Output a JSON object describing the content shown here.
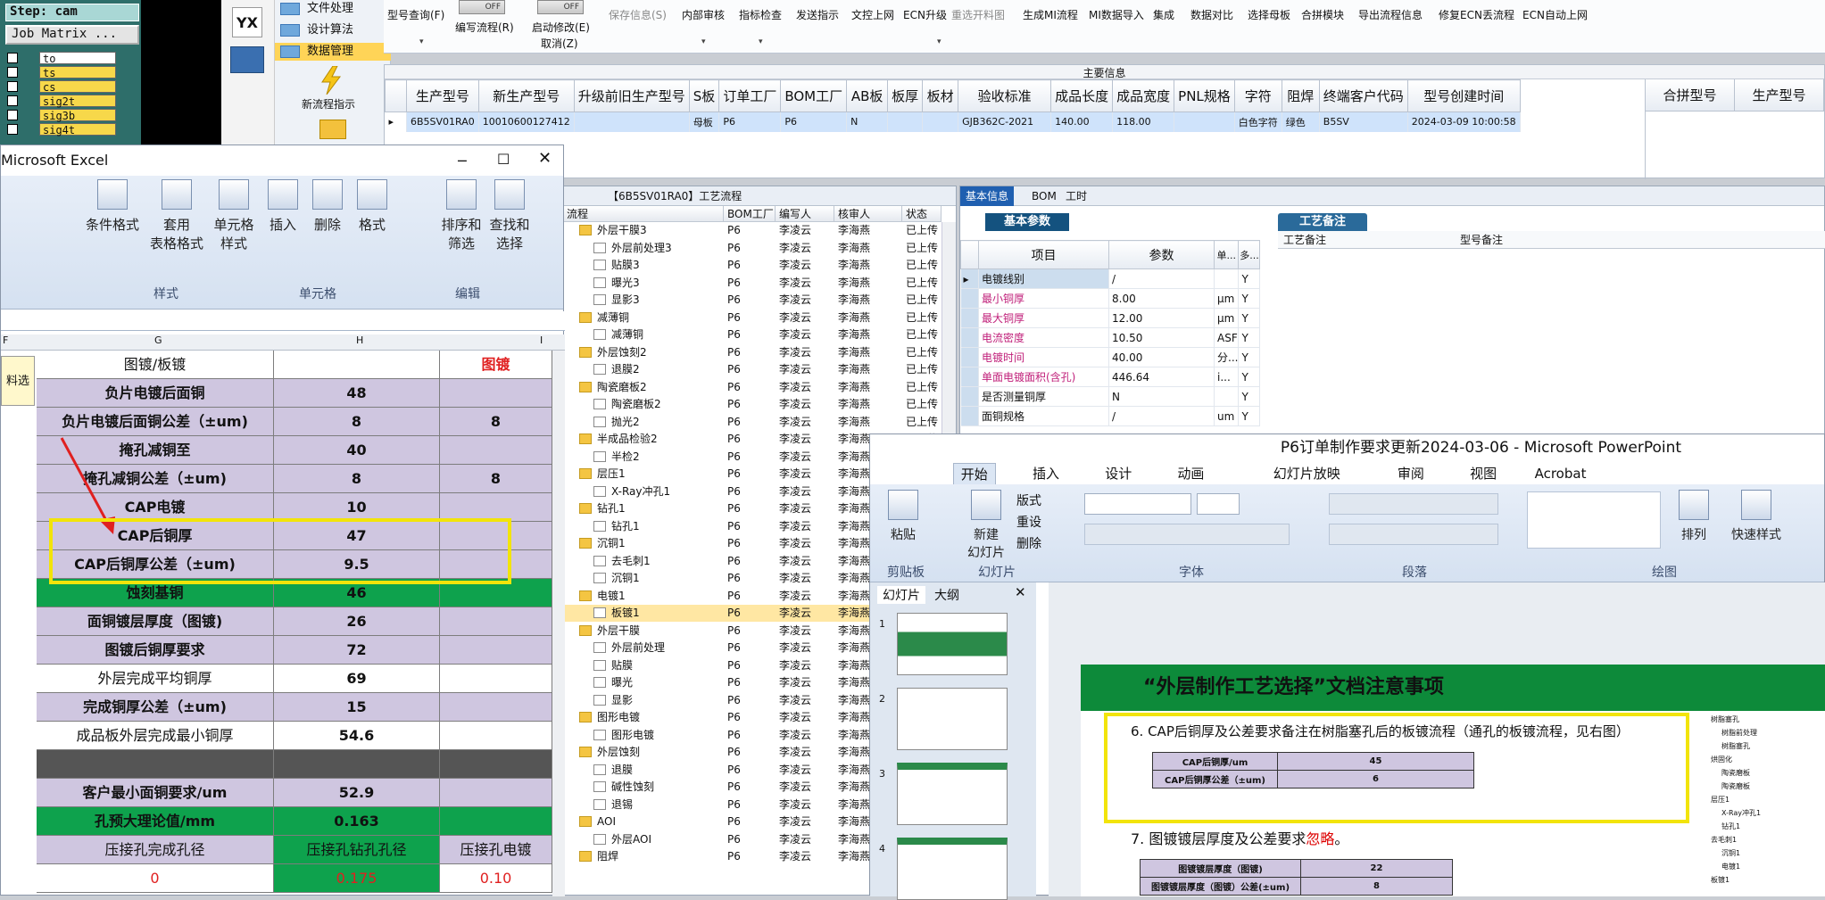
{
  "genesis": {
    "step": "Step: cam",
    "job_matrix": "Job Matrix ...",
    "layers": [
      "to",
      "ts",
      "cs",
      "sig2t",
      "sig3b",
      "sig4t"
    ]
  },
  "erp_nav": {
    "logo": "YX",
    "new_process": "新流程指示"
  },
  "erp_menu": [
    "文件处理",
    "设计算法",
    "数据管理"
  ],
  "toolbar": {
    "items": [
      "型号查询(F)",
      "编写流程(R)",
      "启动修改(E)",
      "取消(Z)",
      "保存信息(S)",
      "内部审核",
      "指标检查",
      "发送指示",
      "文控上网",
      "ECN升级",
      "重选开料图",
      "生成MI流程",
      "MI数据导入",
      "集成",
      "数据对比",
      "选择母板",
      "合拼模块",
      "导出流程信息",
      "修复ECN丢流程",
      "ECN自动上网"
    ],
    "toggle_off": "OFF"
  },
  "main_info": {
    "caption": "主要信息",
    "columns": [
      "生产型号",
      "新生产型号",
      "升级前旧生产型号",
      "S板",
      "订单工厂",
      "BOM工厂",
      "AB板",
      "板厚",
      "板材",
      "验收标准",
      "成品长度",
      "成品宽度",
      "PNL规格",
      "字符",
      "阻焊",
      "终端客户代码",
      "型号创建时间"
    ],
    "right_columns": [
      "合拼型号",
      "生产型号"
    ],
    "row": [
      "6B5SV01RA0",
      "10010600127412",
      "",
      "母板",
      "P6",
      "P6",
      "N",
      "",
      "",
      "GJB362C-2021",
      "140.00",
      "118.00",
      "",
      "白色字符",
      "绿色",
      "B5SV",
      "2024-03-09 10:00:58"
    ]
  },
  "process": {
    "header": "【6B5SV01RA0】工艺流程",
    "columns": [
      "流程",
      "BOM工厂",
      "编写人",
      "核审人",
      "状态"
    ],
    "rows": [
      {
        "lvl": 1,
        "name": "外层干膜3",
        "f": true
      },
      {
        "lvl": 2,
        "name": "外层前处理3"
      },
      {
        "lvl": 2,
        "name": "贴膜3"
      },
      {
        "lvl": 2,
        "name": "曝光3"
      },
      {
        "lvl": 2,
        "name": "显影3"
      },
      {
        "lvl": 1,
        "name": "减薄铜",
        "f": true
      },
      {
        "lvl": 2,
        "name": "减薄铜"
      },
      {
        "lvl": 1,
        "name": "外层蚀刻2",
        "f": true
      },
      {
        "lvl": 2,
        "name": "退膜2"
      },
      {
        "lvl": 1,
        "name": "陶瓷磨板2",
        "f": true
      },
      {
        "lvl": 2,
        "name": "陶瓷磨板2"
      },
      {
        "lvl": 2,
        "name": "抛光2"
      },
      {
        "lvl": 1,
        "name": "半成品检验2",
        "f": true
      },
      {
        "lvl": 2,
        "name": "半检2"
      },
      {
        "lvl": 1,
        "name": "层压1",
        "f": true
      },
      {
        "lvl": 2,
        "name": "X-Ray冲孔1"
      },
      {
        "lvl": 1,
        "name": "钻孔1",
        "f": true
      },
      {
        "lvl": 2,
        "name": "钻孔1"
      },
      {
        "lvl": 1,
        "name": "沉铜1",
        "f": true
      },
      {
        "lvl": 2,
        "name": "去毛刺1"
      },
      {
        "lvl": 2,
        "name": "沉铜1"
      },
      {
        "lvl": 1,
        "name": "电镀1",
        "f": true
      },
      {
        "lvl": 2,
        "name": "板镀1",
        "sel": true
      },
      {
        "lvl": 1,
        "name": "外层干膜",
        "f": true
      },
      {
        "lvl": 2,
        "name": "外层前处理"
      },
      {
        "lvl": 2,
        "name": "贴膜"
      },
      {
        "lvl": 2,
        "name": "曝光"
      },
      {
        "lvl": 2,
        "name": "显影"
      },
      {
        "lvl": 1,
        "name": "图形电镀",
        "f": true
      },
      {
        "lvl": 2,
        "name": "图形电镀"
      },
      {
        "lvl": 1,
        "name": "外层蚀刻",
        "f": true
      },
      {
        "lvl": 2,
        "name": "退膜"
      },
      {
        "lvl": 2,
        "name": "碱性蚀刻"
      },
      {
        "lvl": 2,
        "name": "退锡"
      },
      {
        "lvl": 1,
        "name": "AOI",
        "f": true
      },
      {
        "lvl": 2,
        "name": "外层AOI"
      },
      {
        "lvl": 1,
        "name": "阻焊",
        "f": true
      }
    ],
    "bom": "P6",
    "writer": "李凌云",
    "checker": "李海燕",
    "status": "已上传"
  },
  "basic": {
    "tabs": [
      "基本信息",
      "BOM",
      "工时"
    ],
    "params_title": "基本参数",
    "remarks_title": "工艺备注",
    "remarks_cols": [
      "工艺备注",
      "型号备注"
    ],
    "cols": [
      "项目",
      "参数",
      "单...",
      "多..."
    ],
    "rows": [
      [
        "电镀线别",
        "/",
        "",
        "Y"
      ],
      [
        "最小铜厚",
        "8.00",
        "μm",
        "Y"
      ],
      [
        "最大铜厚",
        "12.00",
        "μm",
        "Y"
      ],
      [
        "电流密度",
        "10.50",
        "ASF",
        "Y"
      ],
      [
        "电镀时间",
        "40.00",
        "分...",
        "Y"
      ],
      [
        "单面电镀面积(含孔)",
        "446.64",
        "i...",
        "Y"
      ],
      [
        "是否测量铜厚",
        "N",
        "",
        "Y"
      ],
      [
        "面铜规格",
        "/",
        "um",
        "Y"
      ]
    ]
  },
  "excel": {
    "title": "Microsoft Excel",
    "ribbon": [
      "条件格式",
      "套用\n表格格式",
      "单元格\n样式",
      "插入",
      "删除",
      "格式",
      "排序和\n筛选",
      "查找和\n选择"
    ],
    "groups": [
      "样式",
      "单元格",
      "编辑"
    ],
    "cols": [
      "F",
      "G",
      "H",
      "I"
    ],
    "side_text": "料选",
    "rows": [
      {
        "label": "图镀/板镀",
        "h": "",
        "i": "图镀",
        "cls": "wht",
        "hi": "red"
      },
      {
        "label": "负片电镀后面铜",
        "h": "48",
        "i": "",
        "cls": "lav"
      },
      {
        "label": "负片电镀后面铜公差（±um)",
        "h": "8",
        "i": "8",
        "cls": "lav"
      },
      {
        "label": "掩孔减铜至",
        "h": "40",
        "i": "",
        "cls": "lav"
      },
      {
        "label": "掩孔减铜公差（±um)",
        "h": "8",
        "i": "8",
        "cls": "lav"
      },
      {
        "label": "CAP电镀",
        "h": "10",
        "i": "",
        "cls": "lav"
      },
      {
        "label": "CAP后铜厚",
        "h": "47",
        "i": "",
        "cls": "lav"
      },
      {
        "label": "CAP后铜厚公差（±um)",
        "h": "9.5",
        "i": "",
        "cls": "lav"
      },
      {
        "label": "蚀刻基铜",
        "h": "46",
        "i": "",
        "cls": "grn"
      },
      {
        "label": "面铜镀层厚度（图镀)",
        "h": "26",
        "i": "",
        "cls": "lav"
      },
      {
        "label": "图镀后铜厚要求",
        "h": "72",
        "i": "",
        "cls": "lav"
      },
      {
        "label": "外层完成平均铜厚",
        "h": "69",
        "i": "",
        "cls": "wht"
      },
      {
        "label": "完成铜厚公差（±um)",
        "h": "15",
        "i": "",
        "cls": "lav"
      },
      {
        "label": "成品板外层完成最小铜厚",
        "h": "54.6",
        "i": "",
        "cls": "wht"
      },
      {
        "label": "",
        "h": "",
        "i": "",
        "cls": "gry"
      },
      {
        "label": "客户最小面铜要求/um",
        "h": "52.9",
        "i": "",
        "cls": "lav"
      },
      {
        "label": "孔预大理论值/mm",
        "h": "0.163",
        "i": "",
        "cls": "grn"
      },
      {
        "label": "压接孔完成孔径",
        "h": "压接孔钻孔孔径",
        "i": "压接孔电镀",
        "cls": "wht2"
      },
      {
        "label": "0",
        "h": "0.175",
        "i": "0.10",
        "cls": "num"
      }
    ]
  },
  "ppt": {
    "title": "P6订单制作要求更新2024-03-06 - Microsoft PowerPoint",
    "tabs": [
      "开始",
      "插入",
      "设计",
      "动画",
      "幻灯片放映",
      "审阅",
      "视图",
      "Acrobat"
    ],
    "groups": [
      "剪贴板",
      "幻灯片",
      "字体",
      "段落",
      "绘图"
    ],
    "buttons": {
      "paste": "粘贴",
      "new_slide": "新建\n幻灯片",
      "layout": "版式",
      "reset": "重设",
      "delete": "删除",
      "arrange": "排列",
      "quick_style": "快速样式"
    },
    "panel_tabs": [
      "幻灯片",
      "大纲"
    ],
    "slide_title": "“外层制作工艺选择”文档注意事项",
    "item6": "6.  CAP后铜厚及公差要求备注在树脂塞孔后的板镀流程（通孔的板镀流程，见右图）",
    "tbl6": [
      [
        "CAP后铜厚/um",
        "45"
      ],
      [
        "CAP后铜厚公差（±um)",
        "6"
      ]
    ],
    "item7a": "7.  图镀镀层厚度及公差要求",
    "item7b": "忽略",
    "item7c": "。",
    "tbl7": [
      [
        "图镀镀层厚度（图镀)",
        "22"
      ],
      [
        "图镀镀层厚度（图镀）公差(±um)",
        "8"
      ]
    ],
    "mini_tree": [
      "树脂塞孔",
      "树脂前处理",
      "树脂塞孔",
      "烘固化",
      "陶瓷磨板",
      "陶瓷磨板",
      "层压1",
      "X-Ray冲孔1",
      "钻孔1",
      "去毛刺1",
      "沉铜1",
      "电镀1",
      "板镀1"
    ]
  }
}
